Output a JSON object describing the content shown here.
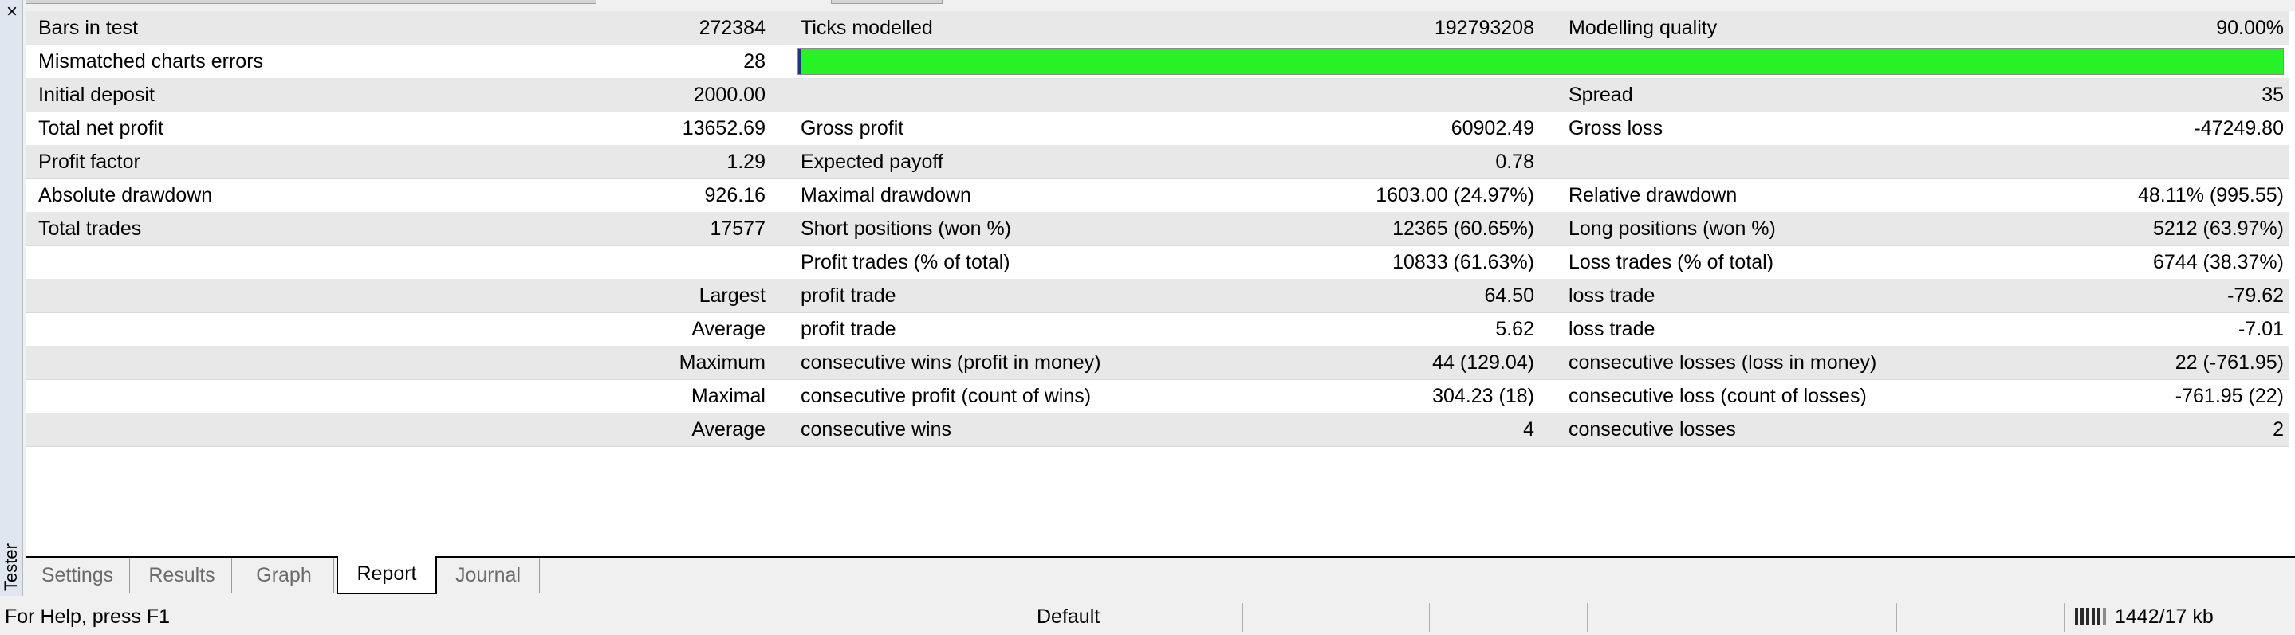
{
  "window": {
    "panel_label": "Tester",
    "close_glyph": "×"
  },
  "report": {
    "rows": [
      {
        "shade": true,
        "cells": [
          {
            "label": "Bars in test",
            "value": "272384"
          },
          {
            "label": "Ticks modelled",
            "value": "192793208"
          },
          {
            "label": "Modelling quality",
            "value": "90.00%"
          }
        ]
      },
      {
        "shade": false,
        "quality_fraction": 0.9,
        "cells": [
          {
            "label": "Mismatched charts errors",
            "value": "28"
          },
          {
            "label": "",
            "value": ""
          },
          {
            "label": "",
            "value": ""
          }
        ]
      },
      {
        "shade": true,
        "cells": [
          {
            "label": "Initial deposit",
            "value": "2000.00"
          },
          {
            "label": "",
            "value": ""
          },
          {
            "label": "Spread",
            "value": "35"
          }
        ]
      },
      {
        "shade": false,
        "cells": [
          {
            "label": "Total net profit",
            "value": "13652.69"
          },
          {
            "label": "Gross profit",
            "value": "60902.49"
          },
          {
            "label": "Gross loss",
            "value": "-47249.80"
          }
        ]
      },
      {
        "shade": true,
        "cells": [
          {
            "label": "Profit factor",
            "value": "1.29"
          },
          {
            "label": "Expected payoff",
            "value": "0.78"
          },
          {
            "label": "",
            "value": ""
          }
        ]
      },
      {
        "shade": false,
        "cells": [
          {
            "label": "Absolute drawdown",
            "value": "926.16"
          },
          {
            "label": "Maximal drawdown",
            "value": "1603.00 (24.97%)"
          },
          {
            "label": "Relative drawdown",
            "value": "48.11% (995.55)"
          }
        ]
      },
      {
        "shade": true,
        "cells": [
          {
            "label": "Total trades",
            "value": "17577"
          },
          {
            "label": "Short positions (won %)",
            "value": "12365 (60.65%)"
          },
          {
            "label": "Long positions (won %)",
            "value": "5212 (63.97%)"
          }
        ]
      },
      {
        "shade": false,
        "cells": [
          {
            "label": "",
            "value": ""
          },
          {
            "label": "Profit trades (% of total)",
            "value": "10833 (61.63%)"
          },
          {
            "label": "Loss trades (% of total)",
            "value": "6744 (38.37%)"
          }
        ]
      },
      {
        "shade": true,
        "cells": [
          {
            "label": "",
            "value": "Largest"
          },
          {
            "label": "profit trade",
            "value": "64.50"
          },
          {
            "label": "loss trade",
            "value": "-79.62"
          }
        ]
      },
      {
        "shade": false,
        "cells": [
          {
            "label": "",
            "value": "Average"
          },
          {
            "label": "profit trade",
            "value": "5.62"
          },
          {
            "label": "loss trade",
            "value": "-7.01"
          }
        ]
      },
      {
        "shade": true,
        "cells": [
          {
            "label": "",
            "value": "Maximum"
          },
          {
            "label": "consecutive wins (profit in money)",
            "value": "44 (129.04)"
          },
          {
            "label": "consecutive losses (loss in money)",
            "value": "22 (-761.95)"
          }
        ]
      },
      {
        "shade": false,
        "cells": [
          {
            "label": "",
            "value": "Maximal"
          },
          {
            "label": "consecutive profit (count of wins)",
            "value": "304.23 (18)"
          },
          {
            "label": "consecutive loss (count of losses)",
            "value": "-761.95 (22)"
          }
        ]
      },
      {
        "shade": true,
        "cells": [
          {
            "label": "",
            "value": "Average"
          },
          {
            "label": "consecutive wins",
            "value": "4"
          },
          {
            "label": "consecutive losses",
            "value": "2"
          }
        ]
      }
    ]
  },
  "tabs": [
    {
      "label": "Settings",
      "active": false
    },
    {
      "label": "Results",
      "active": false
    },
    {
      "label": "Graph",
      "active": false
    },
    {
      "label": "Report",
      "active": true
    },
    {
      "label": "Journal",
      "active": false
    }
  ],
  "statusbar": {
    "help_text": "For Help, press F1",
    "profile": "Default",
    "traffic": "1442/17 kb",
    "connection_icon": "connection-bars-icon"
  },
  "colors": {
    "quality_bar": "#26f226",
    "row_shade": "#e8e8e8"
  }
}
